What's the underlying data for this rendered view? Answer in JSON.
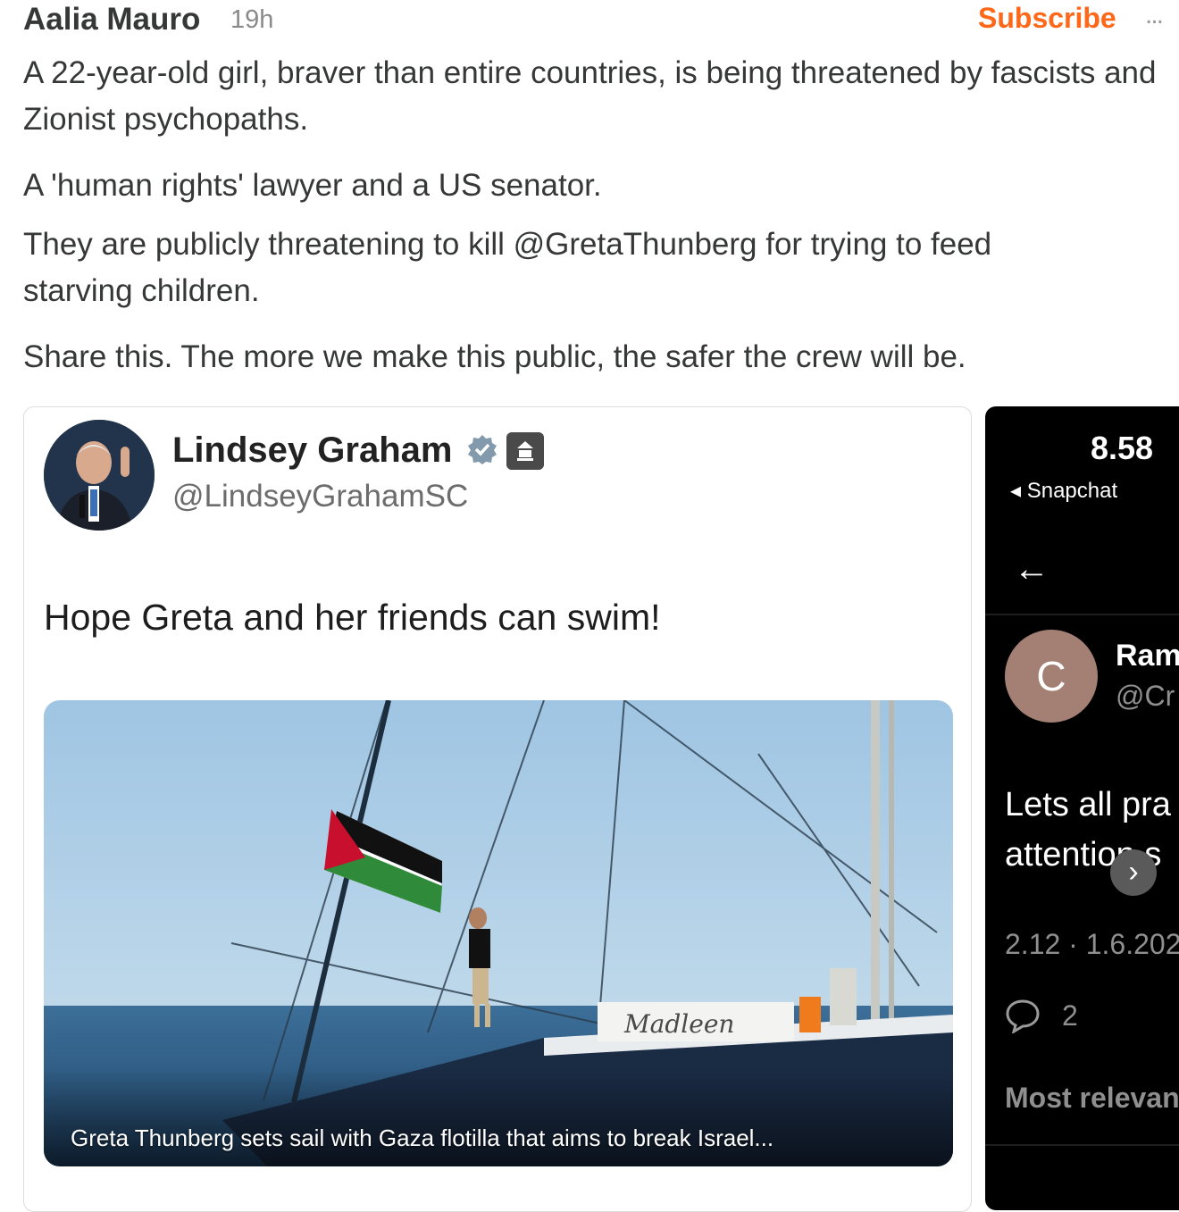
{
  "post": {
    "author": "Aalia Mauro",
    "time": "19h",
    "subscribe_label": "Subscribe",
    "more_label": "...",
    "paragraphs": [
      "A 22-year-old girl, braver than entire countries, is being threatened by fascists and Zionist psychopaths.",
      "A 'human rights' lawyer and a US senator.",
      "They are publicly threatening to kill @GretaThunberg for trying to feed starving children.",
      "Share this. The more we make this public, the safer the crew will be."
    ]
  },
  "embed": {
    "name": "Lindsey Graham",
    "handle": "@LindseyGrahamSC",
    "text": "Hope Greta and her friends can swim!",
    "image": {
      "caption": "Greta Thunberg sets sail with Gaza flotilla that aims to break Israel...",
      "boat_name": "Madleen"
    }
  },
  "snapchat": {
    "time": "8.58",
    "back_label": "◂ Snapchat",
    "arrow": "←",
    "avatar_letter": "C",
    "name": "Ram",
    "handle": "@Cr",
    "text_line1": "Lets all pra",
    "text_line2": "attention s",
    "date": "2.12 · 1.6.202",
    "comment_count": "2",
    "sort_label": "Most relevan",
    "next_glyph": "›"
  },
  "colors": {
    "accent": "#ff6719",
    "verified": "#829aab"
  }
}
